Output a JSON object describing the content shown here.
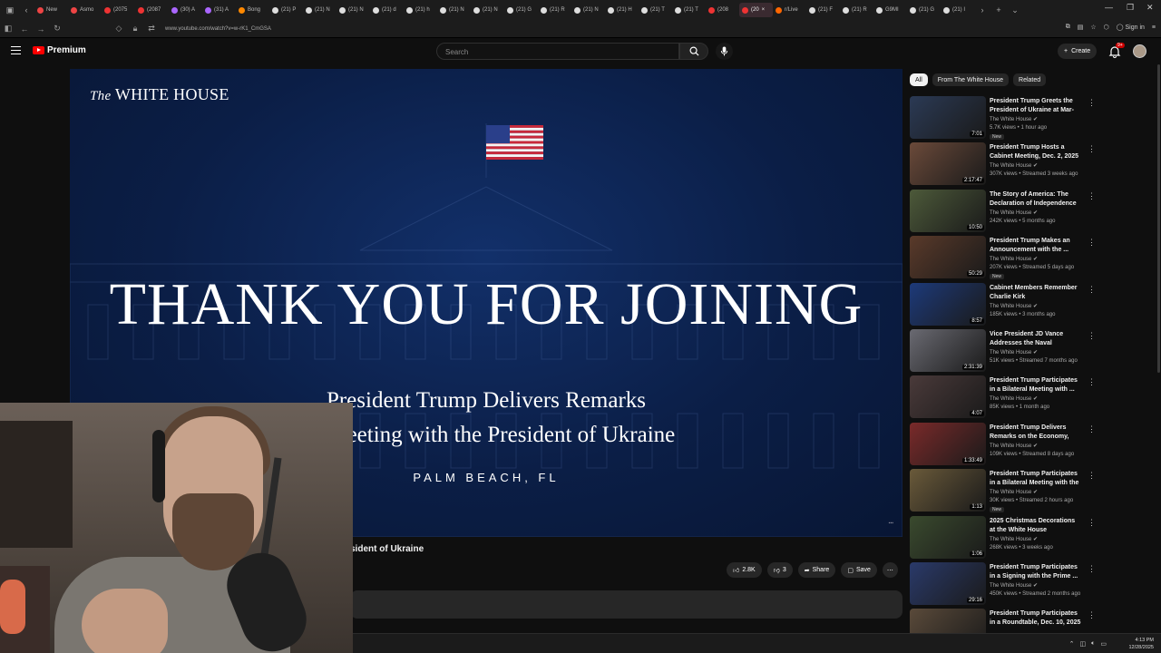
{
  "browser": {
    "tabs": [
      {
        "label": "New",
        "color": "#e44"
      },
      {
        "label": "Asmo",
        "color": "#e44"
      },
      {
        "label": "(2075",
        "color": "#e33"
      },
      {
        "label": "(2087",
        "color": "#e33"
      },
      {
        "label": "(30) A",
        "color": "#a6f"
      },
      {
        "label": "(31) A",
        "color": "#a6f"
      },
      {
        "label": "Bong",
        "color": "#f80"
      },
      {
        "label": "(21) P",
        "color": "#ddd"
      },
      {
        "label": "(21) N",
        "color": "#ddd"
      },
      {
        "label": "(21) N",
        "color": "#ddd"
      },
      {
        "label": "(21) d",
        "color": "#ddd"
      },
      {
        "label": "(21) h",
        "color": "#ddd"
      },
      {
        "label": "(21) N",
        "color": "#ddd"
      },
      {
        "label": "(21) N",
        "color": "#ddd"
      },
      {
        "label": "(21) G",
        "color": "#ddd"
      },
      {
        "label": "(21) R",
        "color": "#ddd"
      },
      {
        "label": "(21) N",
        "color": "#ddd"
      },
      {
        "label": "(21) H",
        "color": "#ddd"
      },
      {
        "label": "(21) T",
        "color": "#ddd"
      },
      {
        "label": "(21) T",
        "color": "#ddd"
      },
      {
        "label": "(208",
        "color": "#e33"
      },
      {
        "label": "(20",
        "color": "#e33",
        "active": true
      },
      {
        "label": "r/Live",
        "color": "#f60"
      },
      {
        "label": "(21) F",
        "color": "#ddd"
      },
      {
        "label": "(21) R",
        "color": "#ddd"
      },
      {
        "label": "G9MI",
        "color": "#ddd"
      },
      {
        "label": "(21) G",
        "color": "#ddd"
      },
      {
        "label": "(21) I",
        "color": "#ddd"
      }
    ],
    "url": "www.youtube.com/watch?v=w-rK1_CmGSA",
    "sign_in": "Sign in"
  },
  "header": {
    "logo_text": "Premium",
    "search_placeholder": "Search",
    "create_label": "Create",
    "notif_count": "9+"
  },
  "player": {
    "brand_italic": "The",
    "brand": "WHITE HOUSE",
    "headline": "THANK YOU FOR JOINING",
    "subtitle_1": "President Trump Delivers Remarks",
    "subtitle_2": "ral Meeting with the President of Ukraine",
    "location": "PALM BEACH, FL"
  },
  "video": {
    "title_visible": "sident of Ukraine",
    "likes": "2.8K",
    "dislikes": "3",
    "share": "Share",
    "save": "Save"
  },
  "sidebar": {
    "chips": [
      {
        "label": "All",
        "active": true
      },
      {
        "label": "From The White House",
        "active": false
      },
      {
        "label": "Related",
        "active": false
      }
    ],
    "items": [
      {
        "title": "President Trump Greets the President of Ukraine at Mar-a-...",
        "channel": "The White House",
        "meta": "5.7K views • 1 hour ago",
        "badge": "New",
        "duration": "7:01",
        "thumb": "#2b3a55"
      },
      {
        "title": "President Trump Hosts a Cabinet Meeting, Dec. 2, 2025",
        "channel": "The White House",
        "meta": "307K views • Streamed 3 weeks ago",
        "badge": "",
        "duration": "2:17:47",
        "thumb": "#6b4a3a"
      },
      {
        "title": "The Story of America: The Declaration of Independence",
        "channel": "The White House",
        "meta": "242K views • 5 months ago",
        "badge": "",
        "duration": "10:50",
        "thumb": "#4d5a3a"
      },
      {
        "title": "President Trump Makes an Announcement with the ...",
        "channel": "The White House",
        "meta": "207K views • Streamed 5 days ago",
        "badge": "New",
        "duration": "50:29",
        "thumb": "#5a3a2a"
      },
      {
        "title": "Cabinet Members Remember Charlie Kirk",
        "channel": "The White House",
        "meta": "185K views • 3 months ago",
        "badge": "",
        "duration": "8:57",
        "thumb": "#1d3a7a"
      },
      {
        "title": "Vice President JD Vance Addresses the Naval Academy...",
        "channel": "The White House",
        "meta": "51K views • Streamed 7 months ago",
        "badge": "",
        "duration": "2:31:39",
        "thumb": "#6a6a72"
      },
      {
        "title": "President Trump Participates in a Bilateral Meeting with ...",
        "channel": "The White House",
        "meta": "85K views • 1 month ago",
        "badge": "",
        "duration": "4:07",
        "thumb": "#4a3a3a"
      },
      {
        "title": "President Trump Delivers Remarks on the Economy, Dec...",
        "channel": "The White House",
        "meta": "109K views • Streamed 8 days ago",
        "badge": "",
        "duration": "1:33:49",
        "thumb": "#7a2a2a"
      },
      {
        "title": "President Trump Participates in a Bilateral Meeting with the ...",
        "channel": "The White House",
        "meta": "30K views • Streamed 2 hours ago",
        "badge": "New",
        "duration": "1:13",
        "thumb": "#6a5a3a"
      },
      {
        "title": "2025 Christmas Decorations at the White House",
        "channel": "The White House",
        "meta": "268K views • 3 weeks ago",
        "badge": "",
        "duration": "1:06",
        "thumb": "#3a4a2e"
      },
      {
        "title": "President Trump Participates in a Signing with the Prime ...",
        "channel": "The White House",
        "meta": "450K views • Streamed 2 months ago",
        "badge": "",
        "duration": "29:16",
        "thumb": "#2a3a6a"
      },
      {
        "title": "President Trump Participates in a Roundtable, Dec. 10, 2025",
        "channel": "",
        "meta": "",
        "badge": "",
        "duration": "",
        "thumb": "#5a4a3a"
      }
    ]
  },
  "taskbar": {
    "time": "4:13 PM",
    "date": "12/28/2025"
  }
}
